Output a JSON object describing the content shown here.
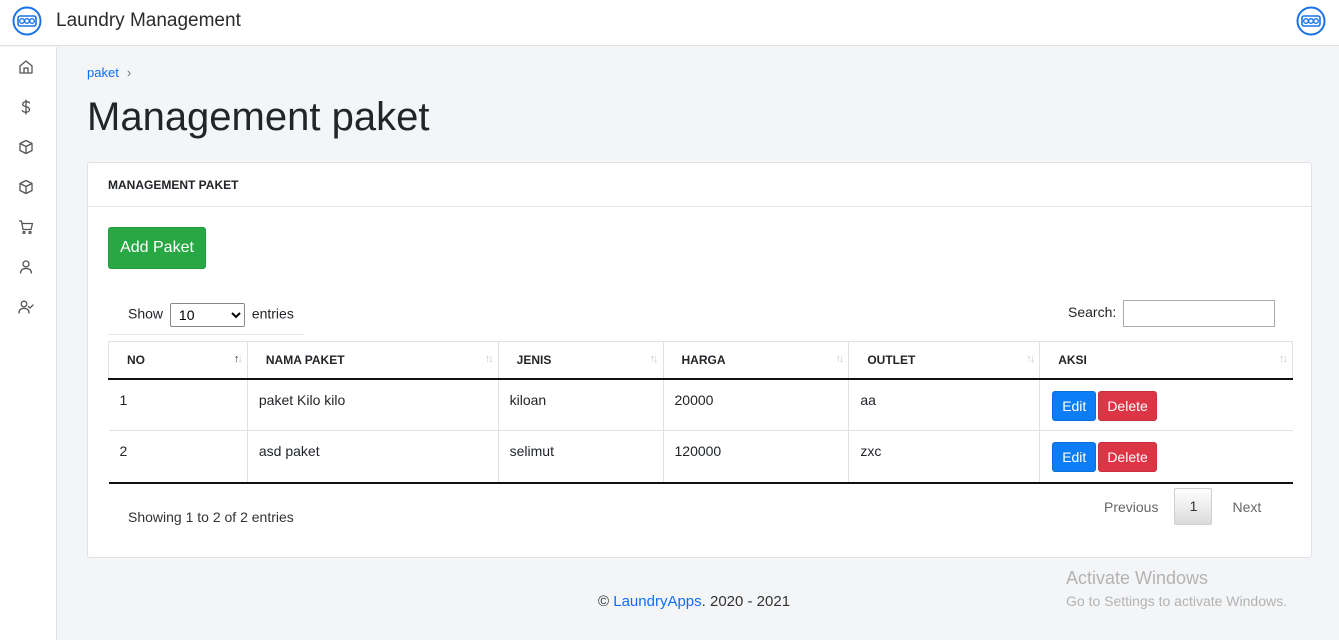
{
  "header": {
    "title": "Laundry Management",
    "logo_icon": "laundry-logo-icon",
    "profile_icon": "laundry-logo-icon"
  },
  "sidebar": {
    "items": [
      {
        "icon": "home-icon"
      },
      {
        "icon": "dollar-icon"
      },
      {
        "icon": "box-icon"
      },
      {
        "icon": "box-icon"
      },
      {
        "icon": "cart-icon"
      },
      {
        "icon": "user-icon"
      },
      {
        "icon": "user-check-icon"
      }
    ]
  },
  "breadcrumb": {
    "item": "paket",
    "separator": "›"
  },
  "page_title": "Management paket",
  "card": {
    "header": "MANAGEMENT PAKET",
    "add_button": "Add Paket",
    "length": {
      "show_label": "Show",
      "selected": "10",
      "entries_label": "entries"
    },
    "search_label": "Search:",
    "table": {
      "columns": [
        "NO",
        "NAMA PAKET",
        "JENIS",
        "HARGA",
        "OUTLET",
        "AKSI"
      ],
      "rows": [
        {
          "no": "1",
          "nama": "paket Kilo kilo",
          "jenis": "kiloan",
          "harga": "20000",
          "outlet": "aa"
        },
        {
          "no": "2",
          "nama": "asd paket",
          "jenis": "selimut",
          "harga": "120000",
          "outlet": "zxc"
        }
      ],
      "edit_label": "Edit",
      "delete_label": "Delete"
    },
    "info": "Showing 1 to 2 of 2 entries",
    "pagination": {
      "previous": "Previous",
      "current": "1",
      "next": "Next"
    }
  },
  "footer": {
    "copyright": "©",
    "brand": "LaundryApps",
    "years": ". 2020 - 2021"
  },
  "watermark": {
    "line1": "Activate Windows",
    "line2": "Go to Settings to activate Windows."
  },
  "colors": {
    "primary": "#0d7df5",
    "success": "#28a745",
    "danger": "#dc3545",
    "link": "#0d6efd"
  }
}
